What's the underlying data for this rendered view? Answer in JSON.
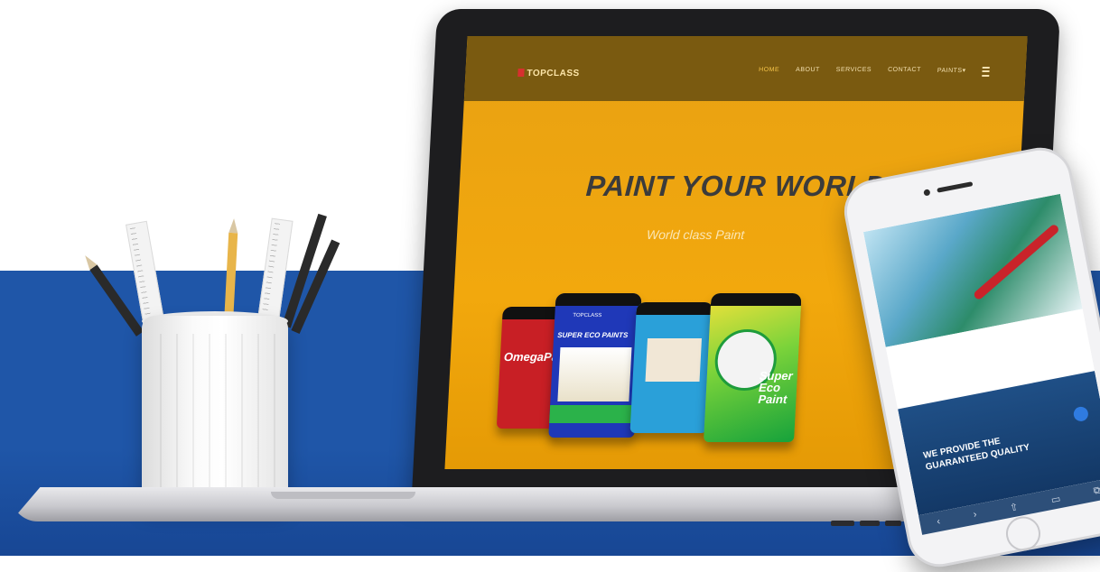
{
  "laptop_site": {
    "brand": "TOPCLASS",
    "nav": [
      "HOME",
      "ABOUT",
      "SERVICES",
      "CONTACT",
      "PAINTS"
    ],
    "nav_paints_caret": "▾",
    "hero_title": "PAINT YOUR WORLD",
    "hero_subtitle": "World class Paint",
    "products": [
      {
        "label": "OmegaPaint"
      },
      {
        "label": "SUPER ECO PAINTS",
        "brand": "TOPCLASS"
      },
      {
        "label": ""
      },
      {
        "label": "Super Eco Paint"
      }
    ]
  },
  "phone_site": {
    "banner_text": "WE PROVIDE THE GUARANTEED QUALITY",
    "toolbar": [
      "‹",
      "›",
      "⇧",
      "▭",
      "⧉"
    ]
  },
  "colors": {
    "background_blue": "#1f56a8",
    "hero_yellow": "#f2a80d",
    "nav_brown": "#7a5a10"
  },
  "icons": [
    "menu-icon",
    "back-icon",
    "forward-icon",
    "share-icon",
    "bookmarks-icon",
    "tabs-icon"
  ]
}
